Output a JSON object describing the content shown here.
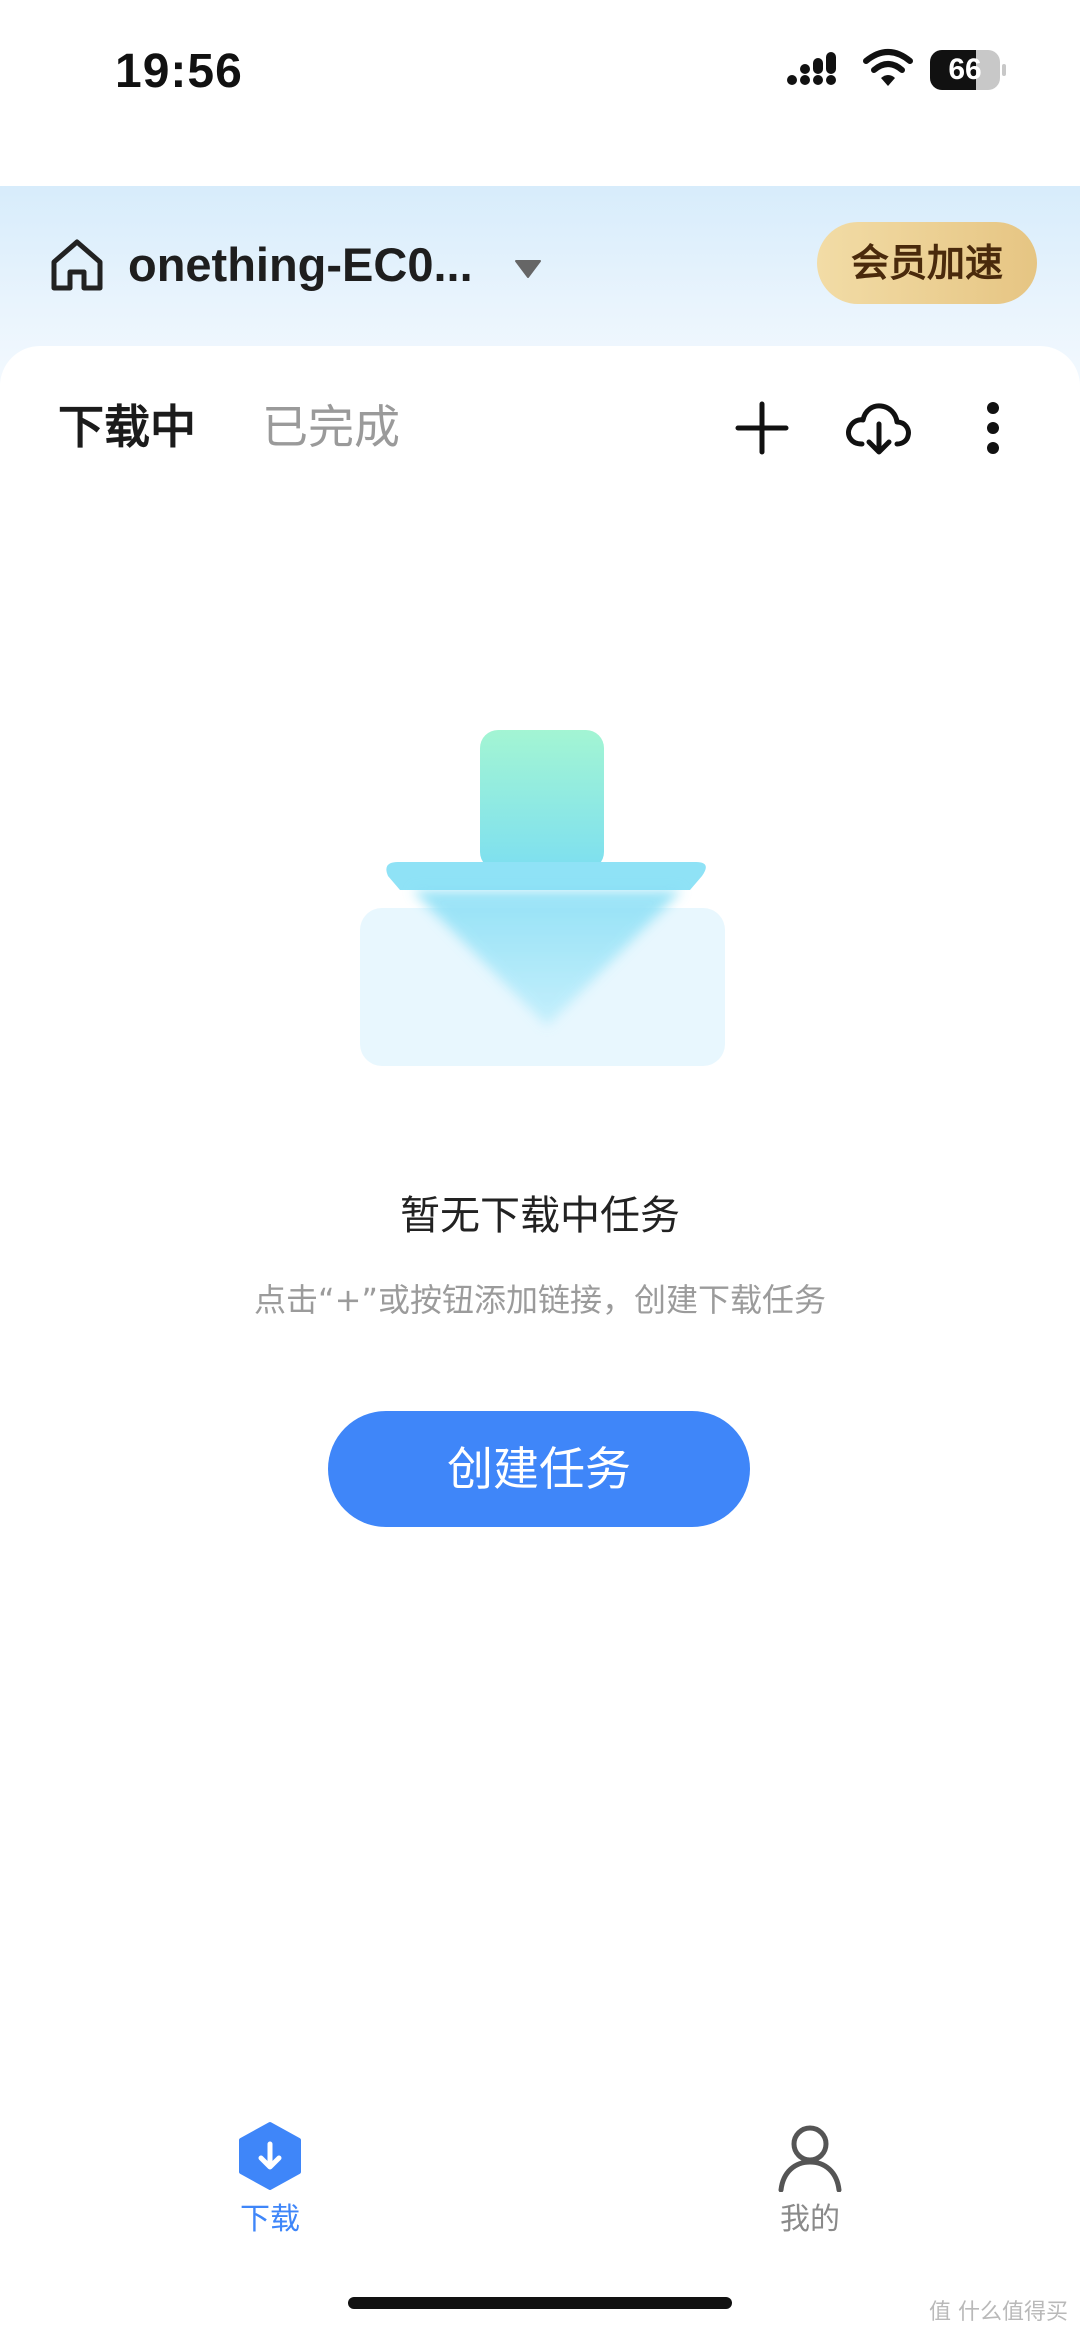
{
  "status_bar": {
    "time": "19:56",
    "battery_level": "66",
    "battery_fraction": 0.66
  },
  "header": {
    "device_name": "onething-EC0...",
    "vip_label": "会员加速"
  },
  "tabs": {
    "active": "下载中",
    "inactive": "已完成"
  },
  "toolbar": {
    "icons": [
      "plus-icon",
      "cloud-download-icon",
      "more-icon"
    ]
  },
  "empty_state": {
    "title": "暂无下载中任务",
    "hint": "点击“+”或按钮添加链接，创建下载任务",
    "button_label": "创建任务"
  },
  "bottom_nav": {
    "items": [
      {
        "label": "下载",
        "icon": "download-hexagon-icon",
        "active": true
      },
      {
        "label": "我的",
        "icon": "person-icon",
        "active": false
      }
    ]
  },
  "watermark": "值 什么值得买",
  "colors": {
    "accent": "#3f86f9",
    "vip_gold": "#e6c583",
    "header_tint": "#d7ecfb"
  }
}
